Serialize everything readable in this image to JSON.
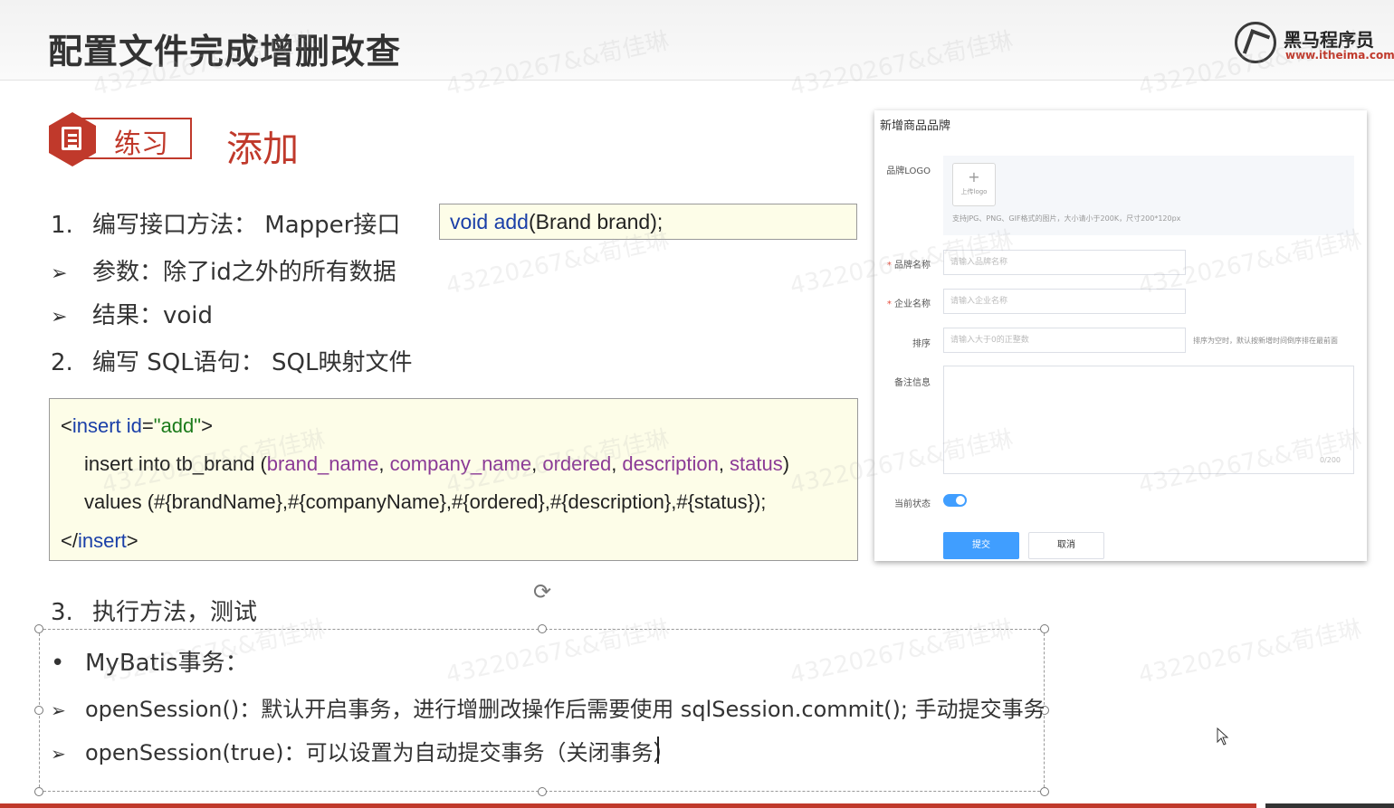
{
  "header": {
    "title": "配置文件完成增删改查",
    "logo_cn": "黑马程序员",
    "logo_url": "www.itheima.com"
  },
  "badge": {
    "label": "练习"
  },
  "section_title": "添加",
  "steps": {
    "step1_num": "1.",
    "step1_text": "编写接口方法： Mapper接口",
    "param": "参数：除了id之外的所有数据",
    "result": "结果：void",
    "step2_num": "2.",
    "step2_text": "编写 SQL语句： SQL映射文件",
    "step3_num": "3.",
    "step3_text": "执行方法，测试"
  },
  "code_inline": {
    "kw": "void add",
    "rest": "(Brand brand);"
  },
  "code_block": {
    "l1_open": "<",
    "l1_tag": "insert",
    "l1_attr": " id",
    "l1_eq": "=",
    "l1_str": "\"add\"",
    "l1_close": ">",
    "l2_pre": "insert into tb_brand (",
    "l2_c1": "brand_name",
    "l2_c2": "company_name",
    "l2_c3": "ordered",
    "l2_c4": "description",
    "l2_c5": "status",
    "l2_sep": ", ",
    "l2_end": ")",
    "l3": "values (#{brandName},#{companyName},#{ordered},#{description},#{status});",
    "l4_open": "</",
    "l4_tag": "insert",
    "l4_close": ">"
  },
  "form": {
    "title": "新增商品品牌",
    "logo_label": "品牌LOGO",
    "upload_plus": "+",
    "upload_label": "上传logo",
    "upload_hint": "支持JPG、PNG、GIF格式的图片，大小请小于200K，尺寸200*120px",
    "brand_label": "品牌名称",
    "brand_placeholder": "请输入品牌名称",
    "company_label": "企业名称",
    "company_placeholder": "请输入企业名称",
    "order_label": "排序",
    "order_placeholder": "请输入大于0的正整数",
    "order_hint": "排序为空时，默认按新增时间倒序排在最前面",
    "desc_label": "备注信息",
    "desc_count": "0/200",
    "status_label": "当前状态",
    "status_on": true,
    "submit": "提交",
    "cancel": "取消",
    "required_mark": "*"
  },
  "notes": {
    "bullet": "•",
    "title": "MyBatis事务：",
    "line1": "openSession()：默认开启事务，进行增删改操作后需要使用 sqlSession.commit(); 手动提交事务",
    "line2": "openSession(true)：可以设置为自动提交事务（关闭事务）"
  },
  "arrow_glyph": "➢",
  "watermark": "43220267&&荀佳琳",
  "colors": {
    "accent": "#c0392b",
    "code_bg": "#fdfde8",
    "keyword": "#1a3fa8",
    "string": "#1a7a1a",
    "column": "#8b3a96",
    "primary_button": "#409eff"
  }
}
